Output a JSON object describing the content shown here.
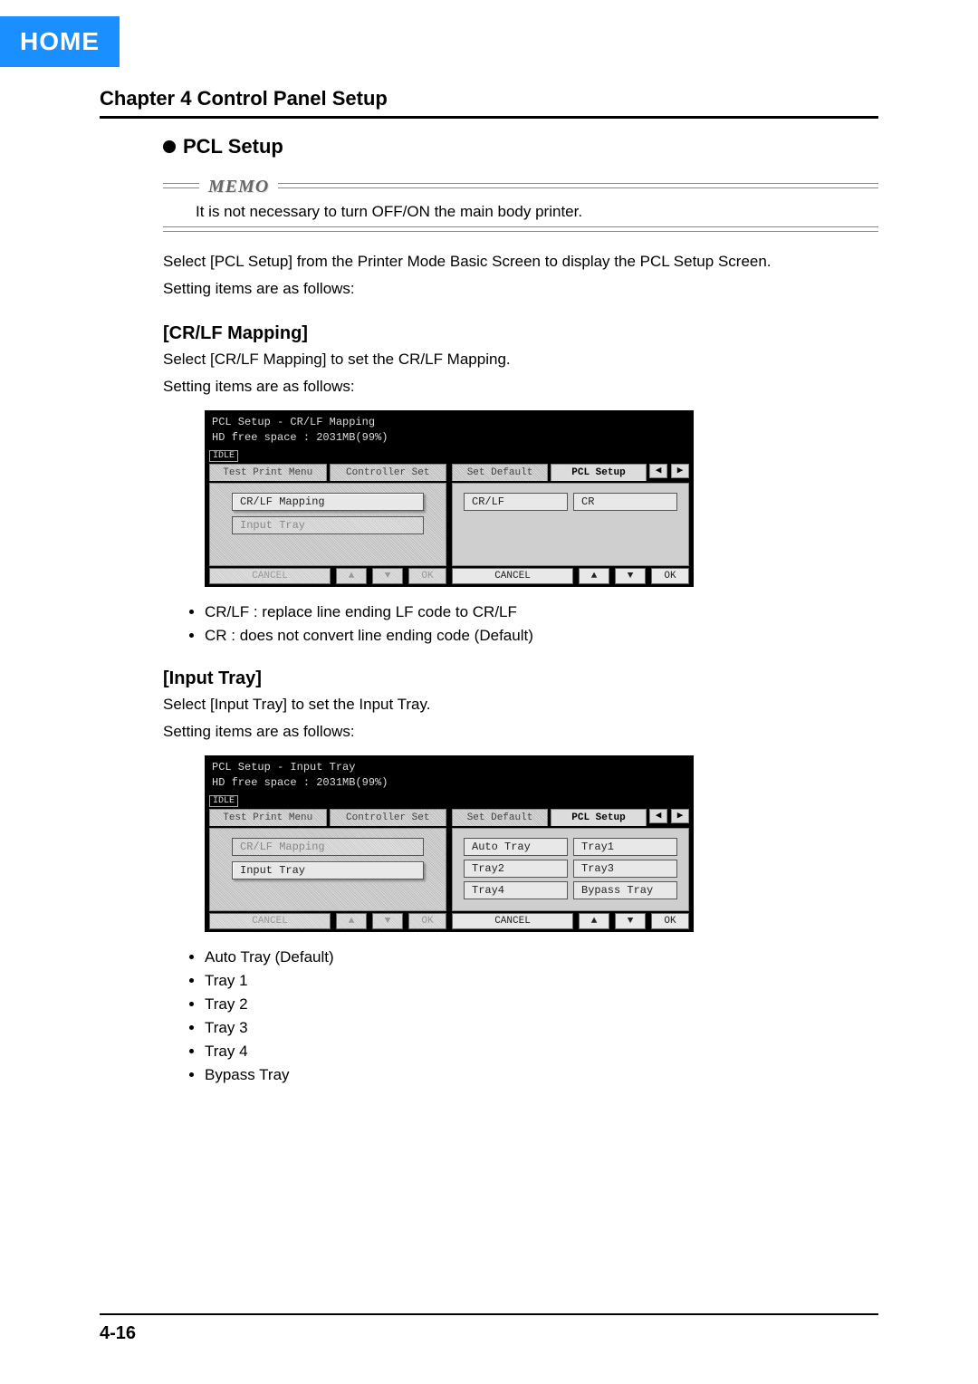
{
  "home_label": "HOME",
  "chapter_title": "Chapter 4 Control Panel Setup",
  "section_title": "PCL Setup",
  "memo": {
    "label": "MEMO",
    "text": "It is not necessary to turn OFF/ON the main body printer."
  },
  "intro1": "Select [PCL Setup] from the Printer Mode Basic Screen to display the PCL Setup Screen.",
  "intro2": "Setting items are as follows:",
  "crlf": {
    "heading": "[CR/LF Mapping]",
    "p1": "Select [CR/LF Mapping] to set the CR/LF Mapping.",
    "p2": "Setting items are as follows:",
    "bullets": [
      "CR/LF : replace line ending LF code to CR/LF",
      "CR : does not convert line ending code (Default)"
    ],
    "lcd": {
      "title": "PCL Setup - CR/LF Mapping",
      "hd": "HD free space : 2031MB(99%)",
      "status": "IDLE",
      "tabs_left": [
        "Test Print Menu",
        "Controller Set"
      ],
      "tabs_right": [
        "Set Default",
        "PCL Setup"
      ],
      "left_items": [
        "CR/LF Mapping",
        "Input Tray"
      ],
      "right_items": [
        "CR/LF",
        "CR"
      ],
      "footer_left": {
        "cancel": "CANCEL",
        "ok": "OK"
      },
      "footer_right": {
        "cancel": "CANCEL",
        "ok": "OK"
      }
    }
  },
  "tray": {
    "heading": "[Input Tray]",
    "p1": "Select [Input Tray] to set the Input Tray.",
    "p2": "Setting items are as follows:",
    "bullets": [
      "Auto Tray (Default)",
      "Tray 1",
      "Tray 2",
      "Tray 3",
      "Tray 4",
      "Bypass Tray"
    ],
    "lcd": {
      "title": "PCL Setup - Input Tray",
      "hd": "HD free space : 2031MB(99%)",
      "status": "IDLE",
      "tabs_left": [
        "Test Print Menu",
        "Controller Set"
      ],
      "tabs_right": [
        "Set Default",
        "PCL Setup"
      ],
      "left_items": [
        "CR/LF Mapping",
        "Input Tray"
      ],
      "right_items": [
        "Auto Tray",
        "Tray1",
        "Tray2",
        "Tray3",
        "Tray4",
        "Bypass Tray"
      ],
      "footer_left": {
        "cancel": "CANCEL",
        "ok": "OK"
      },
      "footer_right": {
        "cancel": "CANCEL",
        "ok": "OK"
      }
    }
  },
  "page_number": "4-16"
}
